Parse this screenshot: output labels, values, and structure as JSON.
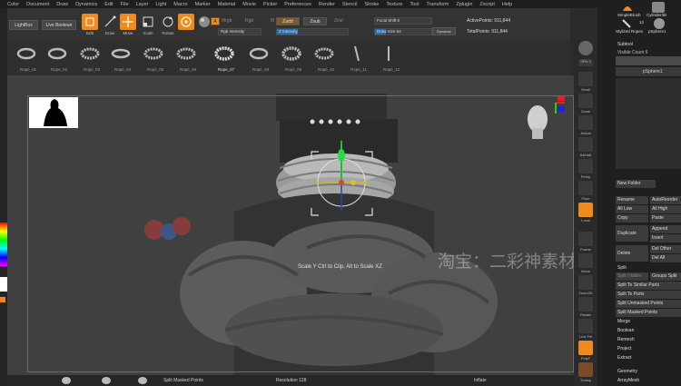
{
  "menu": [
    "Color",
    "Document",
    "Draw",
    "Dynamics",
    "Edit",
    "File",
    "Layer",
    "Light",
    "Macro",
    "Marker",
    "Material",
    "Movie",
    "Picker",
    "Preferences",
    "Render",
    "Stencil",
    "Stroke",
    "Texture",
    "Tool",
    "Transform",
    "Zplugin",
    "Zscript",
    "Help"
  ],
  "toolbar": {
    "lightbox": "LightBox",
    "live_boolean": "Live Boolean",
    "edit": "Edit",
    "draw": "Draw",
    "move": "Move",
    "scale": "Scale",
    "rotate": "Rotate",
    "a_label": "A",
    "mrgb": "Mrgb",
    "rgb": "Rgb",
    "m": "M",
    "zadd": "Zadd",
    "zsub": "Zsub",
    "zcut": "Zcut",
    "rgb_intensity": "Rgb Intensity",
    "z_intensity": "Z Intensity",
    "focal_shift": "Focal Shift 0",
    "draw_size": "Draw Size 64",
    "dynamic": "Dynamic",
    "active_points": "ActivePoints: 911,844",
    "total_points": "TotalPoints: 911,844",
    "brush_highlight": "Rope_07"
  },
  "brushes": [
    "Rope_01",
    "Rope_02",
    "Rope_03",
    "Rope_04",
    "Rope_05",
    "Rope_06",
    "Rope_07",
    "Rope_08",
    "Rope_09",
    "Rope_10",
    "Rope_11",
    "Rope_12",
    "Rope_13"
  ],
  "viewport": {
    "hint": "Scale Y Ctrl to Clip, Alt to Scale XZ",
    "watermark": "淘宝：二彩神素材"
  },
  "right_icons": [
    "SPix 3",
    "Scroll",
    "Zoom",
    "Actual",
    "AAHalf",
    "Persp",
    "Floor",
    "Local",
    "Frame",
    "Move",
    "Zoom3D",
    "Rotate",
    "Line Fill",
    "PolyF",
    "Transp",
    "Ghost",
    "Solo",
    "Xpose",
    "Dynamic"
  ],
  "tray": {
    "brushes_top": [
      "SimpleBrush",
      "Cylinder3D",
      "Stylized Ropes",
      "pSphere1"
    ],
    "brush_count": "12",
    "subtool_header": "Subtool",
    "visible_count": "Visible Count 6",
    "subtool_item": "pSphere1",
    "new_folder": "New Folder",
    "rename": "Rename",
    "autoreorder": "AutoReorder",
    "all_low": "All Low",
    "all_high": "All High",
    "copy": "Copy",
    "paste": "Paste",
    "duplicate": "Duplicate",
    "append": "Append",
    "insert": "Insert",
    "delete": "Delete",
    "del_other": "Del Other",
    "del_all": "Del All",
    "split_header": "Split",
    "split_hidden": "Split Hidden",
    "groups_split": "Groups Split",
    "split_similar": "Split To Similar Parts",
    "split_parts": "Split To Parts",
    "split_unmasked": "Split Unmasked Points",
    "split_masked": "Split Masked Points",
    "merge": "Merge",
    "boolean": "Boolean",
    "remesh": "Remesh",
    "project": "Project",
    "extract": "Extract",
    "geometry": "Geometry",
    "arraymesh": "ArrayMesh"
  },
  "bottom": {
    "split_masked": "Split Masked Points",
    "resolution": "Resolution 128",
    "inflate": "Inflate"
  },
  "colors": {
    "accent": "#f08a1d",
    "panel": "#3b3b3b",
    "background": "#2b2b2b",
    "slider_blue": "#2c6aa8"
  }
}
